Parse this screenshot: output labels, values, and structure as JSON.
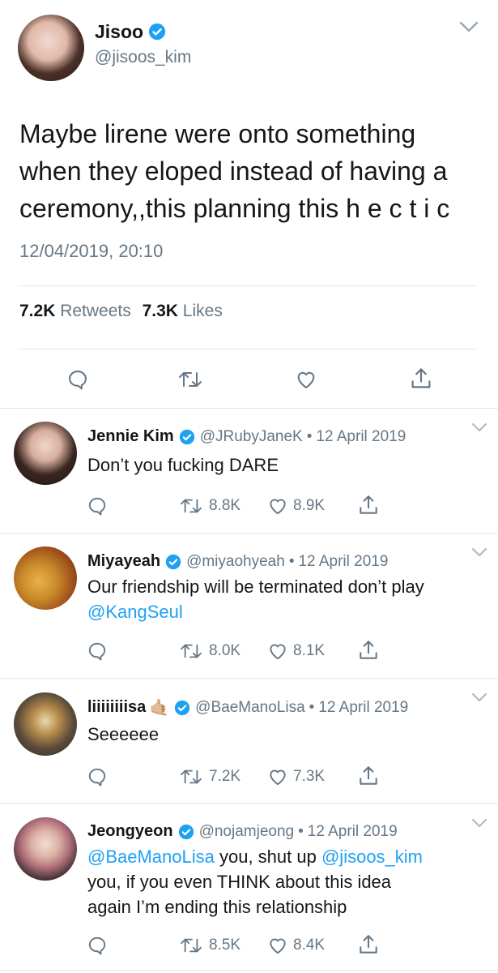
{
  "main_tweet": {
    "name": "Jisoo",
    "handle": "@jisoos_kim",
    "text_lines": [
      "Maybe lirene were onto something",
      "when they eloped instead of having a",
      "ceremony,,this planning this h e c t i c"
    ],
    "timestamp": "12/04/2019, 20:10",
    "retweets_count": "7.2K",
    "retweets_label": "Retweets",
    "likes_count": "7.3K",
    "likes_label": "Likes"
  },
  "replies": [
    {
      "name": "Jennie Kim",
      "handle": "@JRubyJaneK",
      "dot": "•",
      "date": "12 April 2019",
      "lines": [
        "Don’t you fucking DARE"
      ],
      "retweets": "8.8K",
      "likes": "8.9K"
    },
    {
      "name": "Miyayeah",
      "handle": "@miyaohyeah",
      "dot": "•",
      "date": "12 April 2019",
      "line1": "Our friendship will be terminated don’t play",
      "mention": "@KangSeul",
      "retweets": "8.0K",
      "likes": "8.1K"
    },
    {
      "name": "liiiiiiiisa",
      "emoji": "🤙🏼",
      "handle": "@BaeManoLisa",
      "dot": "•",
      "date": "12 April 2019",
      "lines": [
        "Seeeeee"
      ],
      "retweets": "7.2K",
      "likes": "7.3K"
    },
    {
      "name": "Jeongyeon",
      "handle": "@nojamjeong",
      "dot": "•",
      "date": "12 April 2019",
      "line1_mention1": "@BaeManoLisa",
      "line1_text": " you, shut up ",
      "line1_mention2": "@jisoos_kim",
      "line2": "you, if you even THINK about this idea",
      "line3": "again I’m ending this relationship",
      "retweets": "8.5K",
      "likes": "8.4K"
    }
  ],
  "colors": {
    "verified": "#1da1f2",
    "link": "#1da1f2",
    "secondary_text": "#657786",
    "divider": "#e1e8ed"
  },
  "icons": [
    "chevron-down-icon",
    "verified-badge-icon",
    "reply-icon",
    "retweet-icon",
    "like-icon",
    "share-icon"
  ]
}
